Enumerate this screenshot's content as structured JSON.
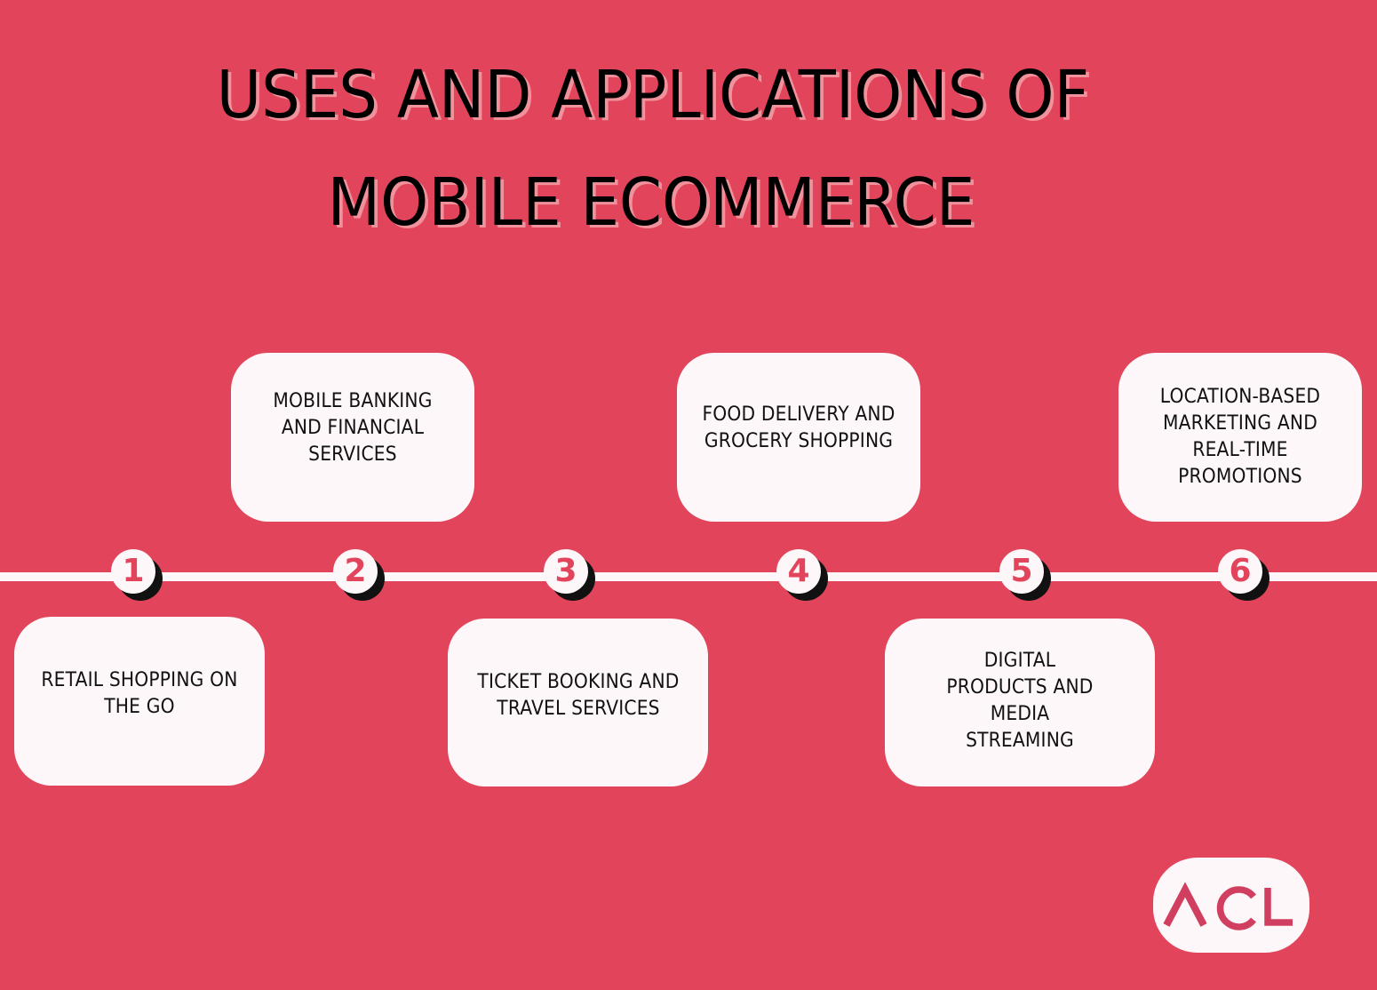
{
  "title": {
    "line1": "USES AND APPLICATIONS OF",
    "line2": "MOBILE ECOMMERCE"
  },
  "colors": {
    "background": "#E2455B",
    "card": "#FDF7F9",
    "title_text": "#000000",
    "title_shadow": "#F0929B",
    "marker_shadow": "#111111",
    "number": "#E2455B",
    "logo_text": "#D03F5F"
  },
  "steps": [
    {
      "number": "1",
      "label": "RETAIL SHOPPING ON THE GO",
      "position": "below"
    },
    {
      "number": "2",
      "label": "MOBILE BANKING AND FINANCIAL SERVICES",
      "position": "above"
    },
    {
      "number": "3",
      "label": "TICKET BOOKING AND TRAVEL SERVICES",
      "position": "below"
    },
    {
      "number": "4",
      "label": "FOOD DELIVERY AND GROCERY SHOPPING",
      "position": "above"
    },
    {
      "number": "5",
      "label": "DIGITAL PRODUCTS AND MEDIA STREAMING",
      "position": "below"
    },
    {
      "number": "6",
      "label": "LOCATION-BASED MARKETING AND REAL-TIME PROMOTIONS",
      "position": "above"
    }
  ],
  "logo": {
    "text": "ACL",
    "icon": "acl-logo-icon"
  }
}
